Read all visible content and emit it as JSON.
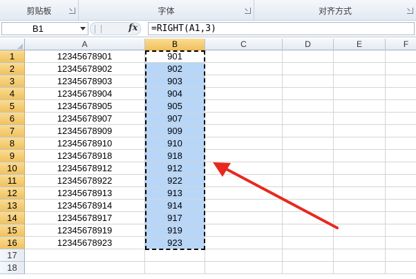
{
  "ribbon": {
    "groups": [
      {
        "label": "剪贴板"
      },
      {
        "label": "字体"
      },
      {
        "label": "对齐方式"
      }
    ]
  },
  "formula_bar": {
    "name_box": "B1",
    "fx_label": "fx",
    "formula": "=RIGHT(A1,3)"
  },
  "columns": [
    "A",
    "B",
    "C",
    "D",
    "E",
    "F"
  ],
  "selected_column": "B",
  "rows": [
    {
      "n": "1",
      "a": "12345678901",
      "b": "901"
    },
    {
      "n": "2",
      "a": "12345678902",
      "b": "902"
    },
    {
      "n": "3",
      "a": "12345678903",
      "b": "903"
    },
    {
      "n": "4",
      "a": "12345678904",
      "b": "904"
    },
    {
      "n": "5",
      "a": "12345678905",
      "b": "905"
    },
    {
      "n": "6",
      "a": "12345678907",
      "b": "907"
    },
    {
      "n": "7",
      "a": "12345678909",
      "b": "909"
    },
    {
      "n": "8",
      "a": "12345678910",
      "b": "910"
    },
    {
      "n": "9",
      "a": "12345678918",
      "b": "918"
    },
    {
      "n": "10",
      "a": "12345678912",
      "b": "912"
    },
    {
      "n": "11",
      "a": "12345678922",
      "b": "922"
    },
    {
      "n": "12",
      "a": "12345678913",
      "b": "913"
    },
    {
      "n": "13",
      "a": "12345678914",
      "b": "914"
    },
    {
      "n": "14",
      "a": "12345678917",
      "b": "917"
    },
    {
      "n": "15",
      "a": "12345678919",
      "b": "919"
    },
    {
      "n": "16",
      "a": "12345678923",
      "b": "923"
    },
    {
      "n": "17",
      "a": "",
      "b": ""
    },
    {
      "n": "18",
      "a": "",
      "b": ""
    }
  ],
  "colors": {
    "selection_fill": "#b8d6f7",
    "header_highlight": "#f1c15f",
    "annotation_arrow": "#e8281e"
  }
}
